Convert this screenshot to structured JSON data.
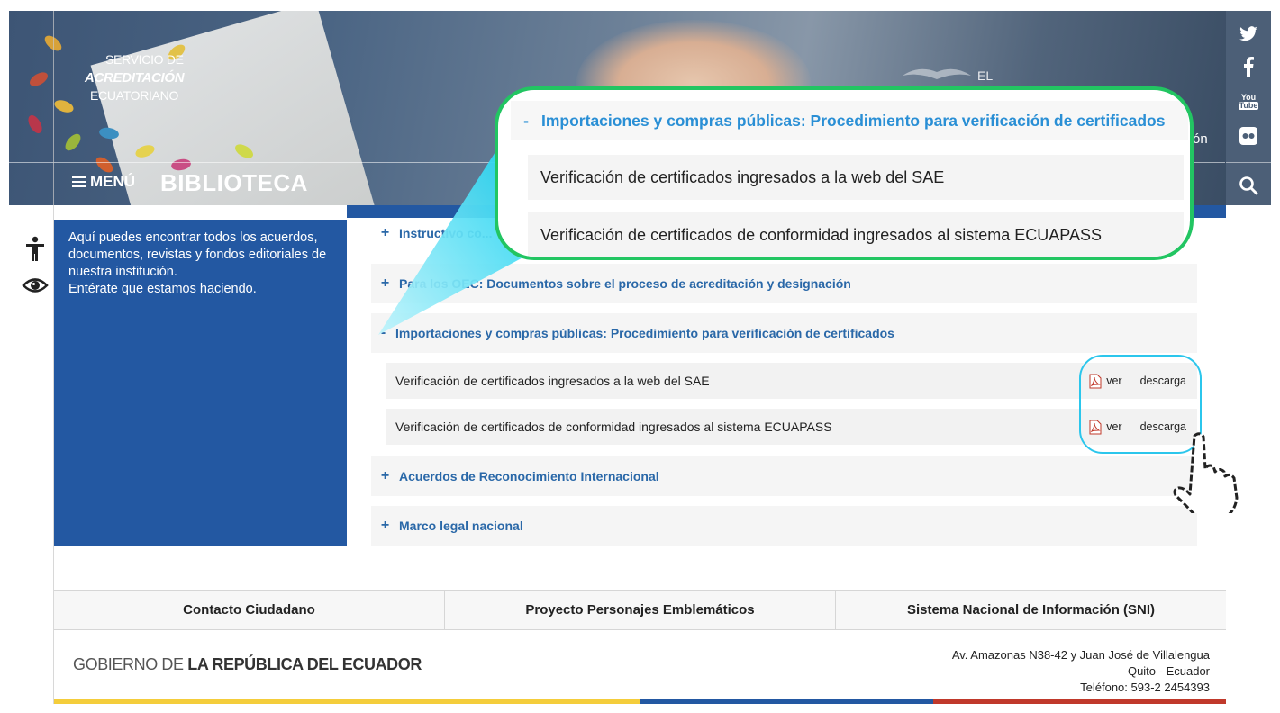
{
  "brand": {
    "line1": "SERVICIO DE",
    "line2": "ACREDITACIÓN",
    "line3": "ECUATORIANO"
  },
  "banner": {
    "emblem_text": "EL",
    "partial_text": "ón"
  },
  "nav": {
    "menu_label": "MENÚ",
    "page_title": "BIBLIOTECA"
  },
  "social": [
    "twitter-icon",
    "facebook-icon",
    "youtube-icon",
    "flickr-icon",
    "search-icon"
  ],
  "intro": {
    "text": "Aquí puedes encontrar todos los acuerdos, documentos, revistas y fondos editoriales de nuestra institución.",
    "text2": "Entérate que estamos haciendo."
  },
  "accordion": [
    {
      "sign": "+",
      "label": "Instructivo co..."
    },
    {
      "sign": "+",
      "label": "Para los OEC: Documentos sobre el proceso de acreditación y designación"
    },
    {
      "sign": "-",
      "label": "Importaciones y compras públicas: Procedimiento para verificación de certificados"
    },
    {
      "sign": "+",
      "label": "Acuerdos de Reconocimiento Internacional"
    },
    {
      "sign": "+",
      "label": "Marco legal nacional"
    }
  ],
  "documents": [
    {
      "title": "Verificación de certificados ingresados a la web del SAE",
      "view": "ver",
      "download": "descarga"
    },
    {
      "title": "Verificación de certificados de conformidad ingresados al sistema ECUAPASS",
      "view": "ver",
      "download": "descarga"
    }
  ],
  "callout": {
    "sign": "-",
    "header": "Importaciones y compras públicas: Procedimiento para verificación de certificados",
    "row1": "Verificación de certificados ingresados a la web del SAE",
    "row2": "Verificación de certificados de conformidad ingresados al sistema ECUAPASS"
  },
  "footer": {
    "links": [
      "Contacto Ciudadano",
      "Proyecto Personajes Emblemáticos",
      "Sistema Nacional de Información (SNI)"
    ],
    "gov_prefix": "GOBIERNO DE ",
    "gov_bold": "LA REPÚBLICA DEL ECUADOR",
    "address1": "Av. Amazonas N38-42 y Juan José de Villalengua",
    "address2": "Quito - Ecuador",
    "address3": "Teléfono: 593-2 2454393"
  },
  "colors": {
    "primary_blue": "#2358a2",
    "link_blue": "#2a68a8",
    "callout_green": "#22c562",
    "highlight_cyan": "#2bc6ec",
    "flag_yellow": "#f4cd3b",
    "flag_blue": "#2358a2",
    "flag_red": "#c0392b"
  }
}
